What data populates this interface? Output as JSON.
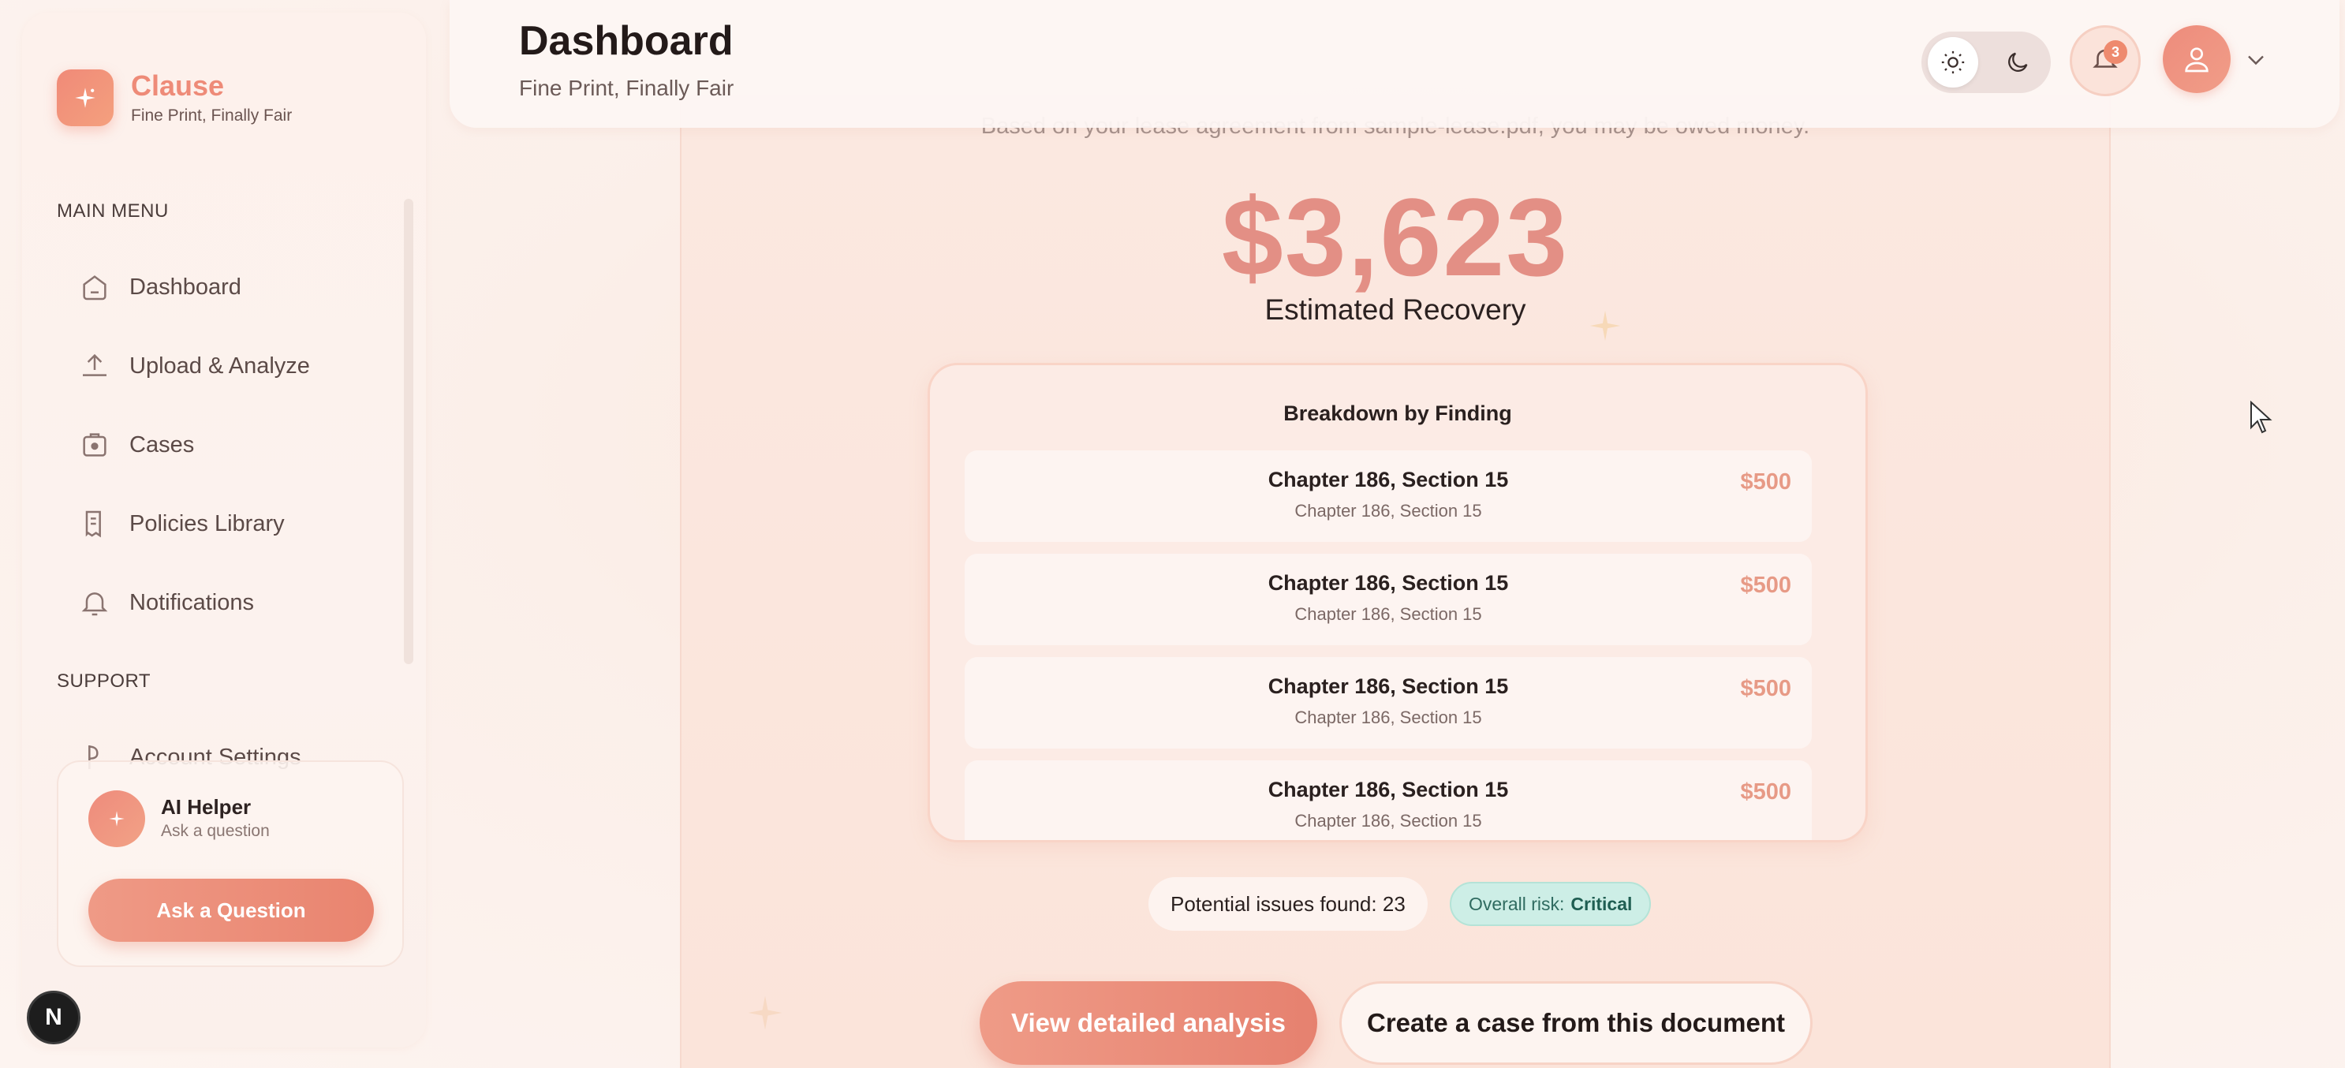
{
  "brand": {
    "name": "Clause",
    "tagline": "Fine Print, Finally Fair"
  },
  "sidebar": {
    "main_menu_label": "MAIN MENU",
    "support_label": "SUPPORT",
    "items": [
      {
        "label": "Dashboard",
        "icon": "home-icon"
      },
      {
        "label": "Upload & Analyze",
        "icon": "upload-icon"
      },
      {
        "label": "Cases",
        "icon": "cases-icon"
      },
      {
        "label": "Policies Library",
        "icon": "document-icon"
      },
      {
        "label": "Notifications",
        "icon": "bell-icon"
      }
    ],
    "support_items": [
      {
        "label": "Account Settings",
        "icon": "settings-icon"
      }
    ],
    "ai_helper": {
      "title": "AI Helper",
      "subtitle": "Ask a question",
      "button": "Ask a Question"
    },
    "footer_badge": "N"
  },
  "header": {
    "title": "Dashboard",
    "subtitle": "Fine Print, Finally Fair",
    "notification_count": "3"
  },
  "main": {
    "intro": "Based on your lease agreement from sample-lease.pdf, you may be owed money.",
    "amount": "$3,623",
    "amount_label": "Estimated Recovery",
    "breakdown_title": "Breakdown by Finding",
    "findings": [
      {
        "title": "Chapter 186, Section 15",
        "subtitle": "Chapter 186, Section 15",
        "amount": "$500"
      },
      {
        "title": "Chapter 186, Section 15",
        "subtitle": "Chapter 186, Section 15",
        "amount": "$500"
      },
      {
        "title": "Chapter 186, Section 15",
        "subtitle": "Chapter 186, Section 15",
        "amount": "$500"
      },
      {
        "title": "Chapter 186, Section 15",
        "subtitle": "Chapter 186, Section 15",
        "amount": "$500"
      }
    ],
    "issues_label": "Potential issues found:",
    "issues_count": "23",
    "risk_label": "Overall risk:",
    "risk_value": "Critical",
    "primary_button": "View detailed analysis",
    "secondary_button": "Create a case from this document"
  },
  "colors": {
    "accent": "#ee8b78",
    "amount": "#e38f85",
    "risk_bg": "#cdeee6"
  }
}
